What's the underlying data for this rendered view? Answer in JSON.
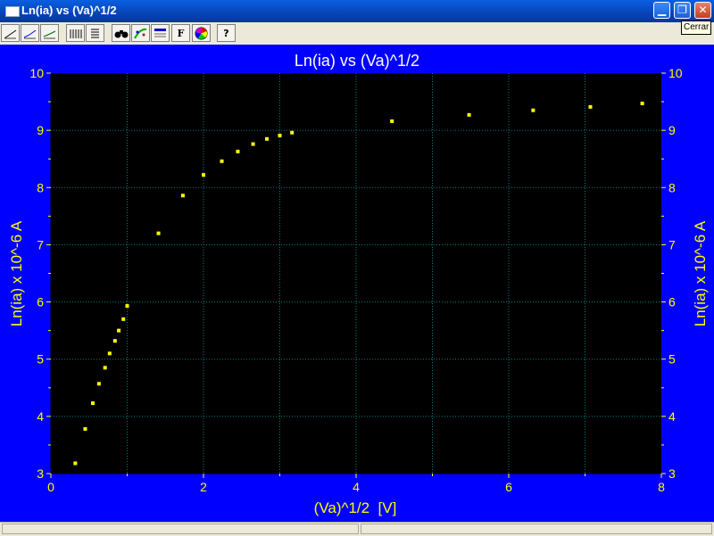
{
  "window": {
    "title": "Ln(ia) vs (Va)^1/2",
    "close_tooltip": "Cerrar"
  },
  "toolbar": {
    "buttons": [
      {
        "name": "line-style-1-icon"
      },
      {
        "name": "line-style-2-icon"
      },
      {
        "name": "line-style-3-icon"
      },
      {
        "name": "data-columns-icon"
      },
      {
        "name": "data-list-icon"
      },
      {
        "name": "binoculars-icon"
      },
      {
        "name": "fit-curve-icon"
      },
      {
        "name": "table-icon"
      },
      {
        "name": "font-icon",
        "glyph": "F"
      },
      {
        "name": "color-wheel-icon"
      },
      {
        "name": "help-icon",
        "glyph": "?"
      }
    ]
  },
  "colors": {
    "frame_bg": "#0000ff",
    "plot_bg": "#000000",
    "text": "#ffff00",
    "title_text": "#ffffff",
    "grid": "#008080",
    "points": "#ffff00"
  },
  "chart_data": {
    "type": "scatter",
    "title": "Ln(ia) vs (Va)^1/2",
    "xlabel": "(Va)^1/2  [V]",
    "ylabel": "Ln(ia) x 10^-6 A",
    "ylabel_right": "Ln(ia) x 10^-6 A",
    "xlim": [
      0,
      8
    ],
    "ylim": [
      3,
      10
    ],
    "xticks": [
      "0",
      "2",
      "4",
      "6",
      "8"
    ],
    "yticks": [
      "3",
      "4",
      "5",
      "6",
      "7",
      "8",
      "9",
      "10"
    ],
    "grid": true,
    "legend": "none",
    "points": [
      {
        "x": 0.32,
        "y": 3.18
      },
      {
        "x": 0.45,
        "y": 3.78
      },
      {
        "x": 0.55,
        "y": 4.23
      },
      {
        "x": 0.63,
        "y": 4.57
      },
      {
        "x": 0.71,
        "y": 4.85
      },
      {
        "x": 0.77,
        "y": 5.1
      },
      {
        "x": 0.84,
        "y": 5.32
      },
      {
        "x": 0.89,
        "y": 5.5
      },
      {
        "x": 0.95,
        "y": 5.7
      },
      {
        "x": 1.0,
        "y": 5.93
      },
      {
        "x": 1.41,
        "y": 7.2
      },
      {
        "x": 1.73,
        "y": 7.86
      },
      {
        "x": 2.0,
        "y": 8.22
      },
      {
        "x": 2.24,
        "y": 8.46
      },
      {
        "x": 2.45,
        "y": 8.63
      },
      {
        "x": 2.65,
        "y": 8.76
      },
      {
        "x": 2.83,
        "y": 8.85
      },
      {
        "x": 3.0,
        "y": 8.91
      },
      {
        "x": 3.16,
        "y": 8.96
      },
      {
        "x": 4.47,
        "y": 9.16
      },
      {
        "x": 5.48,
        "y": 9.27
      },
      {
        "x": 6.32,
        "y": 9.35
      },
      {
        "x": 7.07,
        "y": 9.41
      },
      {
        "x": 7.75,
        "y": 9.47
      }
    ]
  }
}
